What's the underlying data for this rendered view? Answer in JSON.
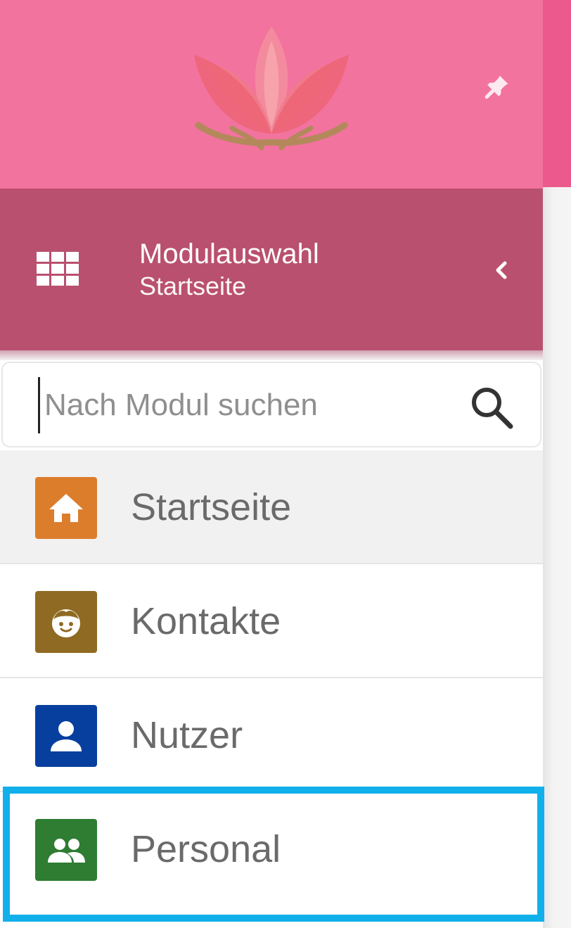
{
  "header": {
    "logo_icon": "lotus-logo",
    "pin_icon": "pin-icon"
  },
  "module_selector": {
    "title": "Modulauswahl",
    "subtitle": "Startseite",
    "grid_icon": "grid-icon",
    "collapse_icon": "chevron-left-icon"
  },
  "search": {
    "placeholder": "Nach Modul suchen",
    "value": "",
    "icon": "search-icon"
  },
  "modules": [
    {
      "label": "Startseite",
      "icon": "home-icon",
      "color": "#dc7d2c",
      "active": true
    },
    {
      "label": "Kontakte",
      "icon": "contact-face-icon",
      "color": "#8f6a22",
      "active": false
    },
    {
      "label": "Nutzer",
      "icon": "user-icon",
      "color": "#073f9e",
      "active": false
    },
    {
      "label": "Personal",
      "icon": "people-icon",
      "color": "#2e7d32",
      "active": false,
      "highlighted": true
    }
  ],
  "colors": {
    "header_pink": "#f2739e",
    "module_header": "#b9506f",
    "highlight": "#11b0ea"
  }
}
